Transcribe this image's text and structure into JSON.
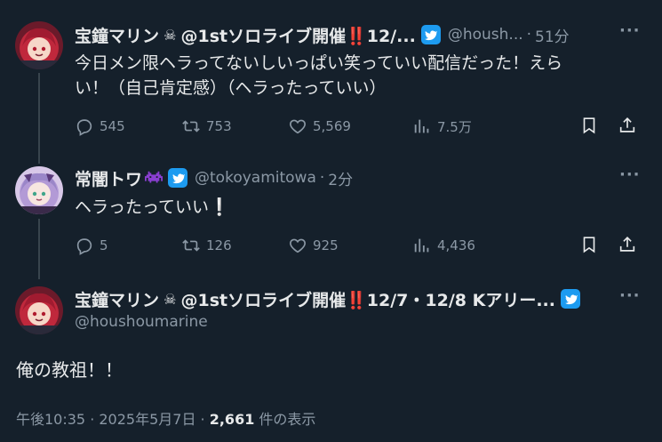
{
  "thread": {
    "tweet1": {
      "display_name": "宝鐘マリン",
      "name_suffix": "@1stソロライブ開催‼️12/...",
      "handle": "@housh...",
      "dot": "·",
      "time": "51分",
      "text_line1": "今日メン限ヘラってないしいっぱい笑っていい配信だった！えら",
      "text_line2": "い！（自己肯定感）（ヘラったっていい）",
      "replies": "545",
      "retweets": "753",
      "likes": "5,569",
      "views": "7.5万"
    },
    "tweet2": {
      "display_name": "常闇トワ",
      "handle": "@tokoyamitowa",
      "dot": "·",
      "time": "2分",
      "text": "ヘラったっていい❕",
      "replies": "5",
      "retweets": "126",
      "likes": "925",
      "views": "4,436"
    },
    "main": {
      "display_name": "宝鐘マリン",
      "name_suffix": "@1stソロライブ開催‼️12/7・12/8 Kアリー...",
      "handle": "@houshoumarine",
      "text": "俺の教祖！！",
      "timestamp": "午後10:35 · 2025年5月7日 · ",
      "view_count": "2,661",
      "view_label": " 件の表示"
    }
  },
  "icons": {
    "more": "more-icon",
    "reply": "reply-icon",
    "retweet": "retweet-icon",
    "like": "heart-icon",
    "views": "views-icon",
    "bookmark": "bookmark-icon",
    "share": "share-icon",
    "badge": "twitter-bird-icon"
  },
  "colors": {
    "background": "#15202b",
    "text": "#e7e9ea",
    "muted": "#8b98a5",
    "badge": "#1d9bf0"
  }
}
